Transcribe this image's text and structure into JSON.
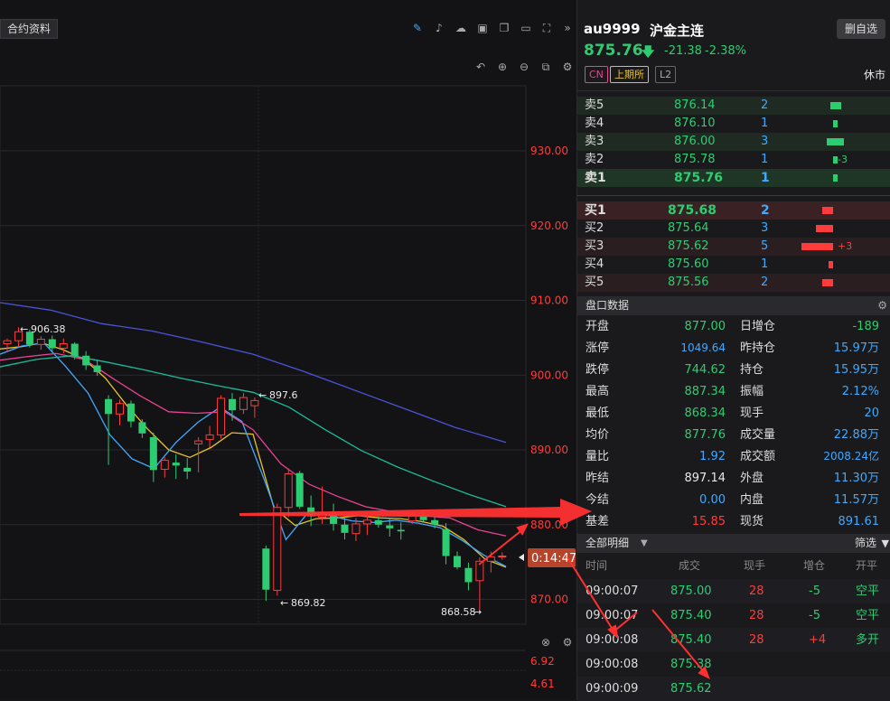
{
  "window": {
    "title_fragment": "mx_04w9vqf9",
    "badge": "L2"
  },
  "toolbar": {
    "contract_info_tab": "合约资料"
  },
  "chart": {
    "price_labels": [
      "930.00",
      "920.00",
      "910.00",
      "900.00",
      "890.00",
      "880.00",
      "870.00"
    ],
    "indicator_labels": [
      "6.92",
      "4.61"
    ],
    "annotations": {
      "high_1": "906.38",
      "high_2": "897.6",
      "low_1": "869.82",
      "low_2": "868.58"
    },
    "countdown": "0:14:47",
    "chart_data": {
      "type": "candlestick",
      "ylim": [
        866,
        936
      ],
      "candles": [
        [
          904.2,
          904.9,
          903.1,
          904.6
        ],
        [
          904.6,
          906.4,
          903.8,
          905.8
        ],
        [
          905.8,
          906.1,
          903.7,
          904.1
        ],
        [
          904.1,
          905.2,
          903.4,
          904.8
        ],
        [
          904.8,
          905.3,
          903.0,
          903.6
        ],
        [
          903.6,
          904.9,
          902.9,
          904.2
        ],
        [
          904.2,
          904.4,
          902.1,
          902.6
        ],
        [
          902.6,
          903.2,
          900.7,
          901.3
        ],
        [
          901.3,
          902.0,
          899.9,
          900.4
        ],
        [
          896.8,
          897.3,
          888.0,
          894.8
        ],
        [
          894.8,
          896.7,
          893.3,
          896.2
        ],
        [
          896.2,
          896.6,
          893.0,
          893.8
        ],
        [
          893.7,
          894.1,
          891.6,
          892.2
        ],
        [
          891.7,
          892.3,
          885.7,
          887.3
        ],
        [
          887.4,
          889.0,
          886.3,
          888.6
        ],
        [
          888.3,
          889.4,
          886.1,
          887.9
        ],
        [
          887.6,
          888.9,
          886.1,
          887.1
        ],
        [
          890.8,
          891.7,
          887.0,
          891.2
        ],
        [
          891.4,
          893.2,
          890.3,
          892.0
        ],
        [
          892.0,
          897.3,
          891.5,
          896.9
        ],
        [
          896.8,
          897.6,
          893.9,
          895.3
        ],
        [
          895.4,
          897.6,
          894.8,
          897.0
        ],
        [
          895.9,
          897.0,
          894.3,
          896.6
        ],
        [
          876.8,
          877.2,
          869.8,
          871.3
        ],
        [
          871.2,
          882.8,
          870.5,
          882.3
        ],
        [
          882.3,
          887.5,
          881.0,
          886.8
        ],
        [
          886.9,
          887.2,
          882.1,
          882.4
        ],
        [
          882.3,
          883.9,
          879.8,
          881.1
        ],
        [
          881.0,
          885.1,
          880.1,
          881.6
        ],
        [
          881.4,
          882.8,
          879.2,
          880.1
        ],
        [
          880.0,
          881.3,
          878.0,
          878.9
        ],
        [
          878.8,
          880.9,
          877.8,
          880.1
        ],
        [
          880.1,
          881.5,
          878.6,
          880.6
        ],
        [
          880.6,
          881.1,
          879.6,
          880.0
        ],
        [
          879.9,
          880.9,
          878.4,
          879.5
        ],
        [
          879.3,
          880.3,
          878.0,
          879.1
        ],
        [
          880.5,
          881.9,
          880.1,
          881.3
        ],
        [
          881.3,
          882.0,
          880.4,
          880.6
        ],
        [
          880.6,
          881.1,
          879.5,
          880.0
        ],
        [
          879.4,
          880.2,
          874.7,
          875.8
        ],
        [
          875.8,
          876.4,
          874.0,
          874.3
        ],
        [
          874.2,
          874.9,
          871.2,
          872.3
        ],
        [
          872.5,
          875.6,
          868.6,
          875.1
        ],
        [
          875.1,
          876.4,
          873.6,
          875.7
        ],
        [
          875.7,
          876.3,
          875.3,
          875.8
        ]
      ],
      "ma_series": [
        {
          "color": "#e6c229",
          "y_points": [
            903.5,
            903.8,
            904.3,
            903.4,
            902.1,
            899.6,
            896.0,
            892.8,
            890.0,
            889.0,
            890.3,
            892.3,
            892.1,
            882.2,
            879.9,
            880.8,
            880.9,
            881.2,
            880.9,
            880.8,
            880.4,
            879.8,
            878.0,
            875.4,
            874.3
          ]
        },
        {
          "color": "#3fa9ff",
          "y_points": [
            902.8,
            903.9,
            904.3,
            901.1,
            897.6,
            892.0,
            888.8,
            887.5,
            891.0,
            893.7,
            895.7,
            893.8,
            886.1,
            878.0,
            881.6,
            881.2,
            880.5,
            880.3,
            880.6,
            880.2,
            879.6,
            877.9,
            875.9,
            874.4
          ]
        },
        {
          "color": "#e84393",
          "y_points": [
            902.0,
            902.5,
            902.9,
            902.1,
            899.6,
            897.2,
            895.1,
            894.9,
            895.1,
            892.7,
            888.1,
            885.4,
            883.8,
            882.4,
            881.7,
            881.2,
            880.9,
            879.3,
            878.5
          ]
        },
        {
          "color": "#1abc9c",
          "y_points": [
            901.1,
            902.1,
            902.6,
            901.7,
            900.7,
            899.6,
            898.6,
            897.7,
            895.7,
            892.7,
            889.9,
            887.7,
            885.8,
            884.0,
            882.4
          ]
        },
        {
          "color": "#4a54d6",
          "y_points": [
            909.7,
            908.7,
            906.9,
            905.9,
            904.4,
            902.8,
            900.5,
            898.0,
            895.5,
            893.0,
            891.0
          ]
        }
      ]
    }
  },
  "header": {
    "symbol": "au9999",
    "name": "沪金主连",
    "delete_button": "删自选",
    "price": "875.76",
    "change": "-21.38",
    "change_pct": "-2.38%",
    "tags": [
      "CN",
      "上期所",
      "L2"
    ],
    "market_status": "休市"
  },
  "orderbook": {
    "asks": [
      {
        "label": "卖5",
        "price": "876.14",
        "qty": "2",
        "bar": 0.35,
        "delta": ""
      },
      {
        "label": "卖4",
        "price": "876.10",
        "qty": "1",
        "bar": 0.15,
        "delta": ""
      },
      {
        "label": "卖3",
        "price": "876.00",
        "qty": "3",
        "bar": 0.55,
        "delta": ""
      },
      {
        "label": "卖2",
        "price": "875.78",
        "qty": "1",
        "bar": 0.15,
        "delta": "-3"
      },
      {
        "label": "卖1",
        "price": "875.76",
        "qty": "1",
        "bar": 0.15,
        "delta": ""
      }
    ],
    "bids": [
      {
        "label": "买1",
        "price": "875.68",
        "qty": "2",
        "bar": 0.35,
        "delta": ""
      },
      {
        "label": "买2",
        "price": "875.64",
        "qty": "3",
        "bar": 0.55,
        "delta": ""
      },
      {
        "label": "买3",
        "price": "875.62",
        "qty": "5",
        "bar": 1.0,
        "delta": "+3"
      },
      {
        "label": "买4",
        "price": "875.60",
        "qty": "1",
        "bar": 0.15,
        "delta": ""
      },
      {
        "label": "买5",
        "price": "875.56",
        "qty": "2",
        "bar": 0.35,
        "delta": ""
      }
    ]
  },
  "stats": {
    "title": "盘口数据",
    "left": [
      {
        "label": "开盘",
        "value": "877.00",
        "color": "green"
      },
      {
        "label": "涨停",
        "value": "1049.64",
        "color": "cyan"
      },
      {
        "label": "跌停",
        "value": "744.62",
        "color": "green"
      },
      {
        "label": "最高",
        "value": "887.34",
        "color": "green"
      },
      {
        "label": "最低",
        "value": "868.34",
        "color": "green"
      },
      {
        "label": "均价",
        "value": "877.76",
        "color": "green"
      },
      {
        "label": "量比",
        "value": "1.92",
        "color": "cyan"
      },
      {
        "label": "昨结",
        "value": "897.14",
        "color": "white"
      },
      {
        "label": "今结",
        "value": "0.00",
        "color": "cyan"
      },
      {
        "label": "基差",
        "value": "15.85",
        "color": "red"
      }
    ],
    "right": [
      {
        "label": "日增仓",
        "value": "-189",
        "color": "green"
      },
      {
        "label": "昨持仓",
        "value": "15.97万",
        "color": "cyan"
      },
      {
        "label": "持仓",
        "value": "15.95万",
        "color": "cyan"
      },
      {
        "label": "振幅",
        "value": "2.12%",
        "color": "cyan"
      },
      {
        "label": "现手",
        "value": "20",
        "color": "cyan"
      },
      {
        "label": "成交量",
        "value": "22.88万",
        "color": "cyan"
      },
      {
        "label": "成交额",
        "value": "2008.24亿",
        "color": "cyan"
      },
      {
        "label": "外盘",
        "value": "11.30万",
        "color": "cyan"
      },
      {
        "label": "内盘",
        "value": "11.57万",
        "color": "cyan"
      },
      {
        "label": "现货",
        "value": "891.61",
        "color": "cyan"
      }
    ]
  },
  "trades": {
    "title": "全部明细",
    "filter": "筛选",
    "columns": [
      "时间",
      "成交",
      "现手",
      "增仓",
      "开平"
    ],
    "rows": [
      {
        "time": "09:00:07",
        "price": "875.00",
        "qty": "28",
        "oi": "-5",
        "type": "空平",
        "type_color": "green"
      },
      {
        "time": "09:00:07",
        "price": "875.40",
        "qty": "28",
        "oi": "-5",
        "type": "空平",
        "type_color": "green"
      },
      {
        "time": "09:00:08",
        "price": "875.40",
        "qty": "28",
        "oi": "+4",
        "type": "多开",
        "type_color": "green"
      },
      {
        "time": "09:00:08",
        "price": "875.38",
        "qty": "",
        "oi": "",
        "type": "",
        "type_color": "green"
      },
      {
        "time": "09:00:09",
        "price": "875.62",
        "qty": "",
        "oi": "",
        "type": "",
        "type_color": "green"
      }
    ]
  }
}
